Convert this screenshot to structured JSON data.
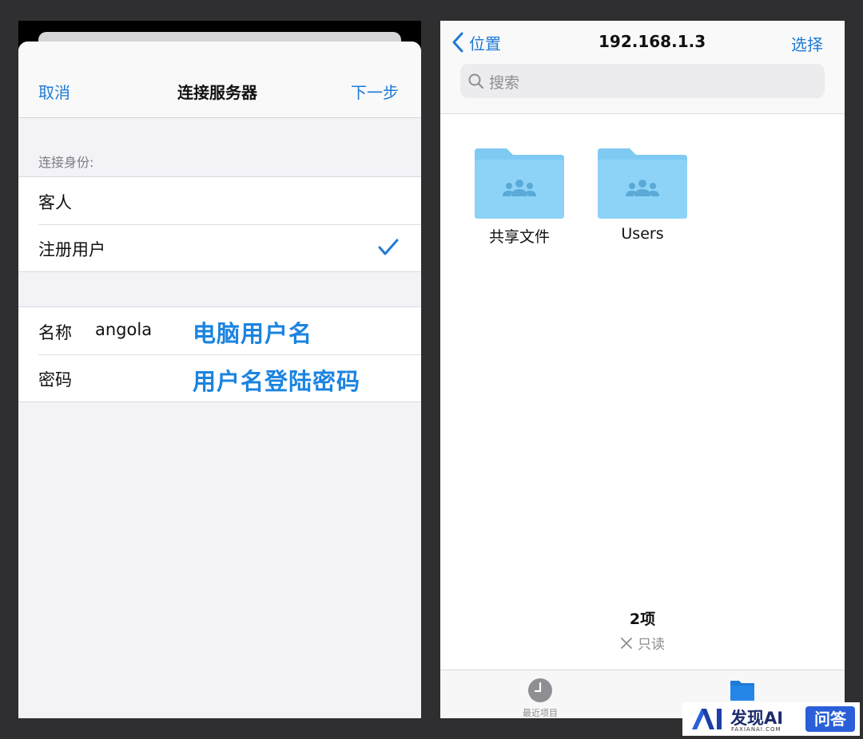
{
  "left_panel": {
    "nav": {
      "cancel": "取消",
      "title": "连接服务器",
      "next": "下一步"
    },
    "identity_header": "连接身份:",
    "identity_options": [
      {
        "label": "客人",
        "selected": false
      },
      {
        "label": "注册用户",
        "selected": true
      }
    ],
    "fields": {
      "name_label": "名称",
      "name_value": "angola",
      "password_label": "密码"
    },
    "annotations": {
      "name_hint": "电脑用户名",
      "password_hint": "用户名登陆密码"
    }
  },
  "right_panel": {
    "nav": {
      "back": "位置",
      "title": "192.168.1.3",
      "select": "选择"
    },
    "search": {
      "placeholder": "搜索"
    },
    "folders": [
      {
        "name": "共享文件",
        "icon": "shared-folder-icon"
      },
      {
        "name": "Users",
        "icon": "shared-folder-icon"
      }
    ],
    "footer": {
      "count": "2项",
      "status": "只读"
    },
    "tabbar": {
      "recents": "最近项目",
      "browse": ""
    }
  },
  "watermark": {
    "logo_text": "发现AI",
    "logo_sub": "FAXIANAI.COM",
    "badge": "问答"
  },
  "colors": {
    "ios_blue": "#1f7ad6",
    "annotation_blue": "#1b84e0",
    "folder_blue": "#7fcaf3",
    "background": "#2f2f31"
  }
}
